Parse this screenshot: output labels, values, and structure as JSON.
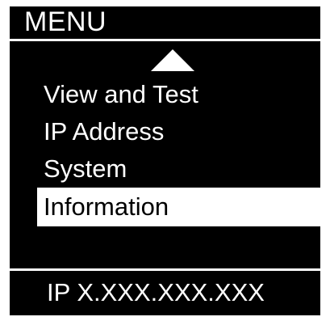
{
  "screen": {
    "title": "MENU",
    "scroll_indicator": "up-arrow-icon",
    "menu_items": [
      {
        "label": "View and Test",
        "selected": false
      },
      {
        "label": "IP Address",
        "selected": false
      },
      {
        "label": "System",
        "selected": false
      },
      {
        "label": "Information",
        "selected": true
      }
    ],
    "status_text": "IP X.XXX.XXX.XXX"
  },
  "colors": {
    "background": "#000000",
    "foreground": "#ffffff",
    "selection_background": "#ffffff",
    "selection_text": "#000000"
  }
}
